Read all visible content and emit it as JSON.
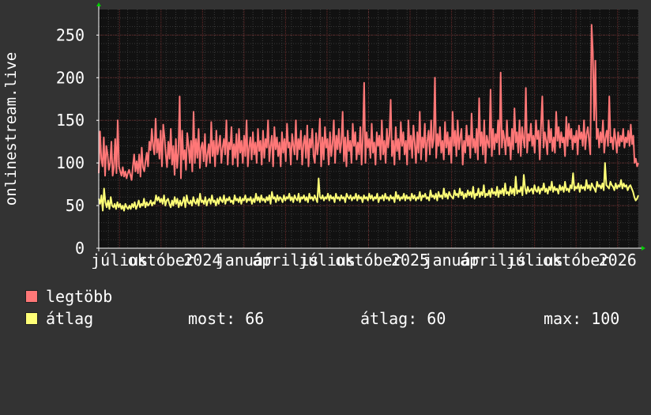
{
  "chart_data": {
    "type": "line",
    "ylabel": "onlinestream.live",
    "ylim": [
      0,
      280
    ],
    "yticks": [
      0,
      50,
      100,
      150,
      200,
      250
    ],
    "x_tick_labels": [
      "július",
      "október",
      "2024",
      "január",
      "április",
      "július",
      "október",
      "2025",
      "január",
      "április",
      "július",
      "október",
      "2026"
    ],
    "grid": true,
    "series": [
      {
        "name": "legtöbb",
        "color": "#ff7777",
        "points_per_day": true,
        "values": [
          88,
          137,
          105,
          96,
          130,
          85,
          120,
          110,
          92,
          100,
          125,
          85,
          95,
          128,
          88,
          150,
          96,
          90,
          85,
          95,
          84,
          90,
          82,
          88,
          92,
          86,
          80,
          96,
          110,
          90,
          102,
          88,
          110,
          84,
          118,
          95,
          90,
          102,
          112,
          96,
          125,
          115,
          140,
          120,
          110,
          152,
          112,
          128,
          105,
          138,
          96,
          145,
          130,
          110,
          95,
          125,
          105,
          140,
          98,
          120,
          86,
          128,
          94,
          112,
          178,
          82,
          138,
          104,
          115,
          92,
          135,
          120,
          100,
          126,
          90,
          160,
          100,
          128,
          106,
          140,
          94,
          118,
          124,
          102,
          134,
          96,
          110,
          122,
          100,
          148,
          108,
          126,
          96,
          138,
          110,
          120,
          132,
          100,
          118,
          128,
          110,
          150,
          98,
          124,
          116,
          142,
          98,
          122,
          106,
          134,
          96,
          140,
          112,
          126,
          100,
          132,
          108,
          150,
          96,
          118,
          130,
          104,
          136,
          110,
          124,
          100,
          140,
          114,
          126,
          98,
          138,
          106,
          128,
          118,
          150,
          102,
          120,
          132,
          96,
          142,
          116,
          130,
          108,
          124,
          96,
          136,
          112,
          128,
          102,
          146,
          118,
          124,
          98,
          134,
          120,
          110,
          150,
          104,
          128,
          116,
          138,
          98,
          122,
          132,
          106,
          144,
          96,
          128,
          118,
          140,
          108,
          100,
          135,
          110,
          125,
          152,
          96,
          130,
          104,
          142,
          118,
          128,
          98,
          136,
          108,
          122,
          150,
          100,
          132,
          116,
          140,
          112,
          124,
          160,
          102,
          130,
          96,
          138,
          114,
          126,
          100,
          146,
          120,
          136,
          104,
          124,
          110,
          142,
          98,
          130,
          194,
          100,
          136,
          118,
          128,
          106,
          146,
          112,
          124,
          98,
          136,
          120,
          132,
          104,
          150,
          110,
          126,
          100,
          140,
          118,
          132,
          174,
          108,
          126,
          98,
          142,
          114,
          128,
          104,
          148,
          120,
          136,
          110,
          126,
          98,
          150,
          116,
          132,
          106,
          144,
          124,
          100,
          136,
          112,
          160,
          104,
          130,
          118,
          146,
          102,
          126,
          138,
          110,
          150,
          118,
          128,
          200,
          106,
          134,
          120,
          142,
          112,
          126,
          104,
          148,
          118,
          136,
          110,
          130,
          100,
          160,
          120,
          138,
          108,
          150,
          116,
          130,
          140,
          98,
          126,
          112,
          144,
          120,
          132,
          106,
          158,
          118,
          128,
          112,
          140,
          104,
          176,
          120,
          136,
          110,
          150,
          100,
          132,
          124,
          118,
          186,
          108,
          140,
          116,
          134,
          124,
          150,
          110,
          206,
          118,
          138,
          128,
          110,
          150,
          120,
          130,
          104,
          140,
          116,
          164,
          124,
          136,
          112,
          150,
          108,
          142,
          128,
          118,
          188,
          112,
          134,
          126,
          146,
          120,
          132,
          112,
          150,
          128,
          138,
          104,
          144,
          178,
          118,
          136,
          126,
          110,
          150,
          124,
          140,
          114,
          130,
          112,
          160,
          126,
          142,
          118,
          136,
          124,
          130,
          108,
          154,
          120,
          146,
          128,
          140,
          116,
          132,
          124,
          138,
          110,
          144,
          128,
          136,
          120,
          150,
          116,
          134,
          142,
          126,
          110,
          262,
          230,
          150,
          220,
          128,
          140,
          118,
          136,
          124,
          150,
          112,
          130,
          138,
          120,
          178,
          124,
          130,
          116,
          140,
          128,
          112,
          136,
          120,
          132,
          125,
          140,
          118,
          130,
          124,
          138,
          120,
          145,
          122,
          132,
          100,
          105,
          96,
          100
        ]
      },
      {
        "name": "átlag",
        "color": "#ffff77",
        "values": [
          58,
          52,
          62,
          44,
          70,
          54,
          48,
          56,
          46,
          60,
          50,
          48,
          52,
          46,
          54,
          48,
          52,
          46,
          50,
          44,
          52,
          48,
          46,
          50,
          46,
          52,
          48,
          54,
          46,
          50,
          56,
          48,
          52,
          50,
          58,
          48,
          54,
          50,
          52,
          56,
          50,
          54,
          52,
          62,
          56,
          60,
          54,
          58,
          52,
          62,
          50,
          56,
          58,
          52,
          48,
          56,
          50,
          60,
          52,
          58,
          48,
          56,
          50,
          54,
          60,
          48,
          62,
          54,
          52,
          56,
          50,
          60,
          54,
          52,
          58,
          50,
          64,
          54,
          56,
          52,
          60,
          50,
          56,
          58,
          52,
          62,
          54,
          56,
          50,
          58,
          52,
          60,
          56,
          54,
          62,
          52,
          58,
          56,
          60,
          54,
          56,
          52,
          62,
          56,
          58,
          54,
          60,
          52,
          58,
          56,
          62,
          54,
          58,
          56,
          60,
          52,
          58,
          54,
          64,
          56,
          60,
          54,
          62,
          56,
          58,
          54,
          60,
          56,
          62,
          52,
          66,
          58,
          60,
          54,
          62,
          56,
          60,
          58,
          54,
          62,
          56,
          60,
          58,
          64,
          56,
          60,
          54,
          62,
          58,
          56,
          64,
          54,
          60,
          58,
          62,
          56,
          60,
          54,
          64,
          58,
          60,
          56,
          62,
          58,
          54,
          82,
          60,
          58,
          62,
          56,
          60,
          58,
          64,
          56,
          62,
          58,
          60,
          54,
          64,
          58,
          60,
          56,
          62,
          58,
          60,
          54,
          64,
          60,
          58,
          62,
          56,
          60,
          58,
          64,
          56,
          62,
          58,
          60,
          54,
          62,
          58,
          60,
          56,
          64,
          58,
          62,
          56,
          60,
          58,
          64,
          54,
          60,
          58,
          62,
          56,
          64,
          58,
          60,
          56,
          62,
          58,
          60,
          54,
          66,
          58,
          62,
          56,
          60,
          58,
          64,
          56,
          62,
          58,
          60,
          56,
          64,
          58,
          62,
          56,
          60,
          58,
          66,
          56,
          62,
          60,
          64,
          58,
          60,
          56,
          68,
          60,
          62,
          58,
          64,
          56,
          66,
          60,
          62,
          58,
          70,
          60,
          64,
          58,
          66,
          62,
          60,
          58,
          68,
          62,
          64,
          60,
          70,
          62,
          66,
          58,
          64,
          60,
          68,
          62,
          66,
          60,
          72,
          58,
          64,
          62,
          70,
          60,
          66,
          62,
          74,
          60,
          64,
          62,
          68,
          60,
          70,
          64,
          66,
          62,
          72,
          60,
          68,
          64,
          70,
          62,
          76,
          64,
          66,
          62,
          72,
          64,
          70,
          62,
          84,
          64,
          68,
          66,
          72,
          62,
          86,
          70,
          64,
          72,
          66,
          68,
          70,
          64,
          74,
          68,
          66,
          72,
          64,
          70,
          68,
          76,
          66,
          70,
          64,
          72,
          68,
          78,
          66,
          72,
          68,
          70,
          64,
          74,
          68,
          72,
          66,
          78,
          68,
          70,
          66,
          74,
          70,
          88,
          68,
          72,
          70,
          76,
          66,
          74,
          70,
          72,
          68,
          80,
          70,
          74,
          68,
          76,
          72,
          70,
          66,
          78,
          72,
          74,
          70,
          76,
          68,
          100,
          74,
          72,
          70,
          78,
          74,
          72,
          68,
          76,
          70,
          74,
          72,
          80,
          70,
          76,
          72,
          74,
          68,
          72,
          74,
          70,
          66,
          60,
          56,
          58,
          62
        ]
      }
    ]
  },
  "legend": {
    "items": [
      {
        "label": "legtöbb",
        "color": "#ff7777"
      },
      {
        "label": "átlag",
        "color": "#ffff77"
      }
    ],
    "stats": {
      "now_label": "most:",
      "now_value": "66",
      "avg_label": "átlag:",
      "avg_value": "60",
      "max_label": "max:",
      "max_value": "100"
    }
  },
  "colors": {
    "background": "#333333",
    "plot_background": "#111111",
    "grid_major": "#6b2a2a",
    "grid_minor": "#3a3a3a",
    "axis": "#ffffff",
    "arrow": "#00cc00"
  }
}
